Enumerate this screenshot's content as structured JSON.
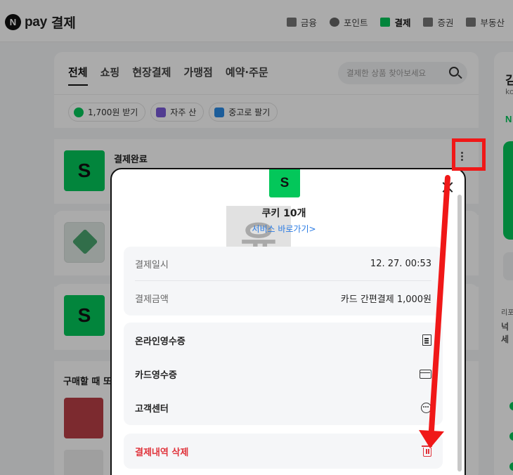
{
  "header": {
    "logo_letter": "N",
    "brand": "pay",
    "title": "결제",
    "nav": [
      {
        "label": "금융",
        "icon": "finance-icon"
      },
      {
        "label": "포인트",
        "icon": "point-icon"
      },
      {
        "label": "결제",
        "icon": "payment-icon",
        "active": true
      },
      {
        "label": "증권",
        "icon": "stock-icon"
      },
      {
        "label": "부동산",
        "icon": "realestate-icon"
      }
    ]
  },
  "tabs": [
    "전체",
    "쇼핑",
    "현장결제",
    "가맹점",
    "예약·주문"
  ],
  "search": {
    "placeholder": "결제한 상품 찾아보세요"
  },
  "chips": [
    "1,700원 받기",
    "자주 산",
    "중고로 팔기"
  ],
  "items": {
    "status": "결제완료",
    "logo_letter": "S"
  },
  "section_title": "구매할 때 또",
  "side": {
    "t1": "김",
    "t2": "ko",
    "n": "N",
    "s1": "리포",
    "s2": "넉",
    "s3": "세"
  },
  "modal": {
    "logo_letter": "S",
    "watermark": "윤",
    "product_name": "쿠키 10개",
    "service_link": "서비스 바로가기>",
    "rows": [
      {
        "label": "결제일시",
        "value": "12. 27. 00:53"
      },
      {
        "label": "결제금액",
        "value": "카드 간편결제 1,000원"
      }
    ],
    "actions": [
      "온라인영수증",
      "카드영수증",
      "고객센터"
    ],
    "delete_label": "결제내역 삭제"
  },
  "colors": {
    "accent": "#03c75a",
    "annotation": "#f01818",
    "danger": "#e0323a",
    "link": "#2a7be4"
  }
}
